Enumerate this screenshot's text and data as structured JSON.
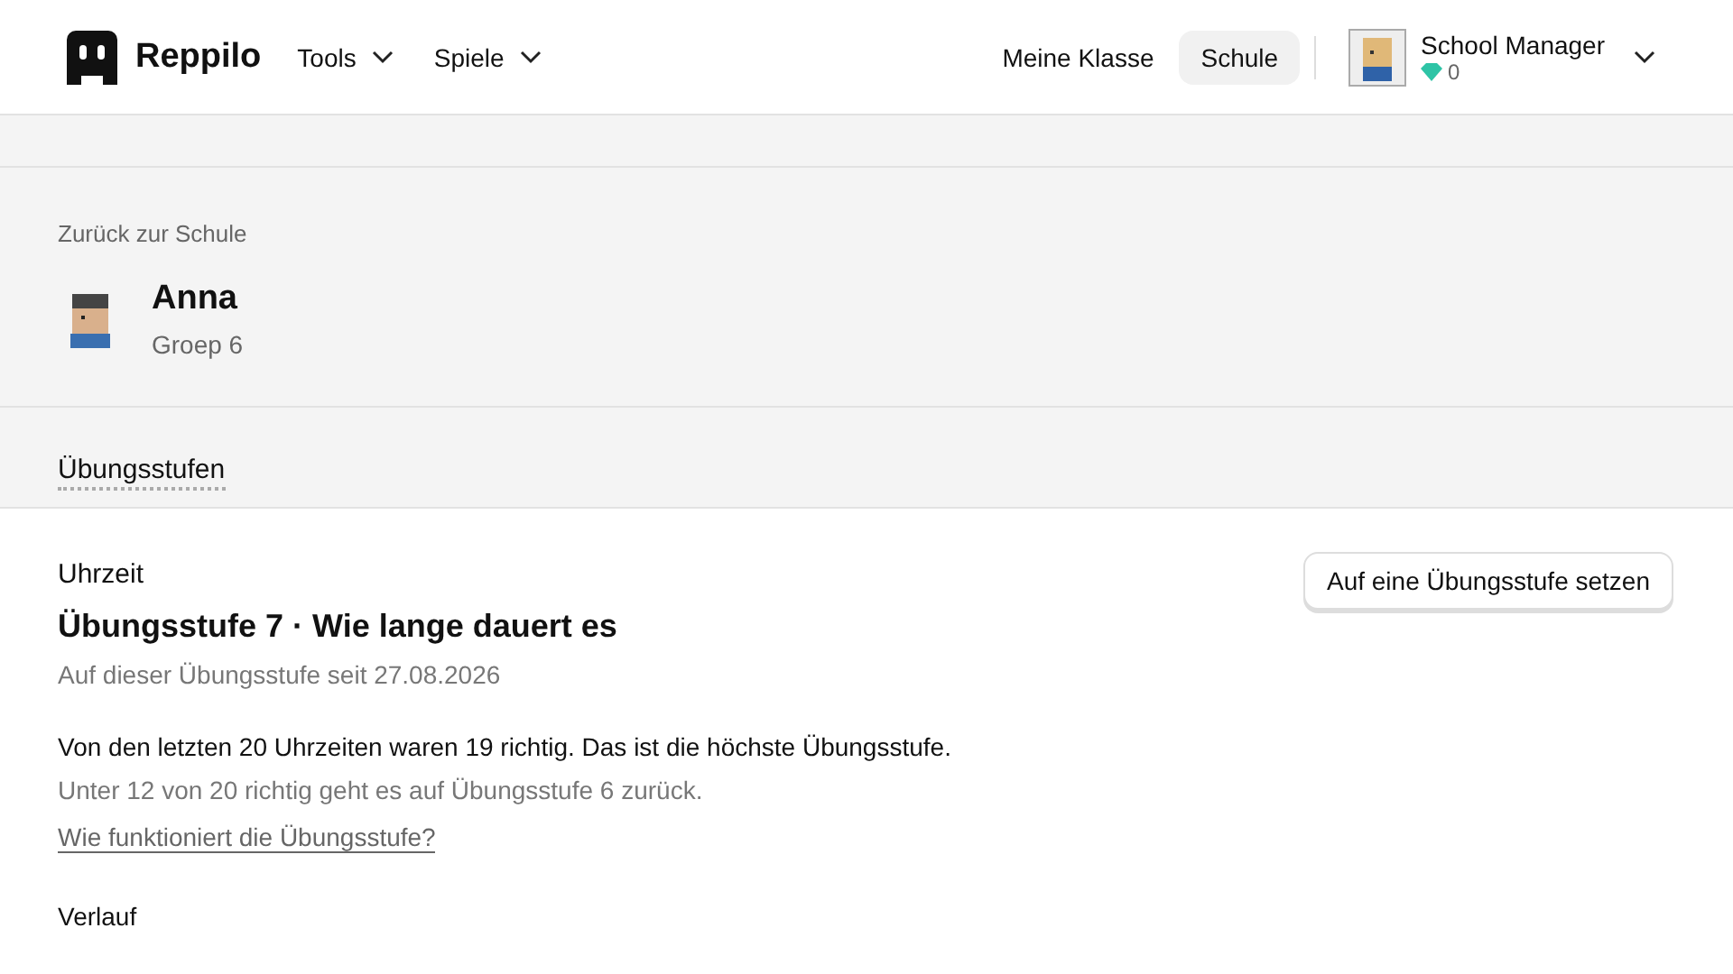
{
  "header": {
    "brand": "Reppilo",
    "menus": [
      {
        "label": "Tools"
      },
      {
        "label": "Spiele"
      }
    ],
    "nav": [
      {
        "label": "Meine Klasse",
        "selected": false
      },
      {
        "label": "Schule",
        "selected": true
      }
    ],
    "user": {
      "name": "School Manager",
      "gems": "0"
    }
  },
  "back_link": "Zurück zur Schule",
  "student": {
    "name": "Anna",
    "group": "Groep 6"
  },
  "tabs": [
    {
      "label": "Übungsstufen",
      "selected": true
    }
  ],
  "card": {
    "subject": "Uhrzeit",
    "title": "Übungsstufe 7 · Wie lange dauert es",
    "since": "Auf dieser Übungsstufe seit 27.08.2026",
    "button": "Auf eine Übungsstufe setzen",
    "summary": "Von den letzten 20 Uhrzeiten waren 19 richtig. Das ist die höchste Übungsstufe.",
    "rule": "Unter 12 von 20 richtig geht es auf Übungsstufe 6 zurück.",
    "help_link": "Wie funktioniert die Übungsstufe?",
    "history_heading": "Verlauf"
  }
}
